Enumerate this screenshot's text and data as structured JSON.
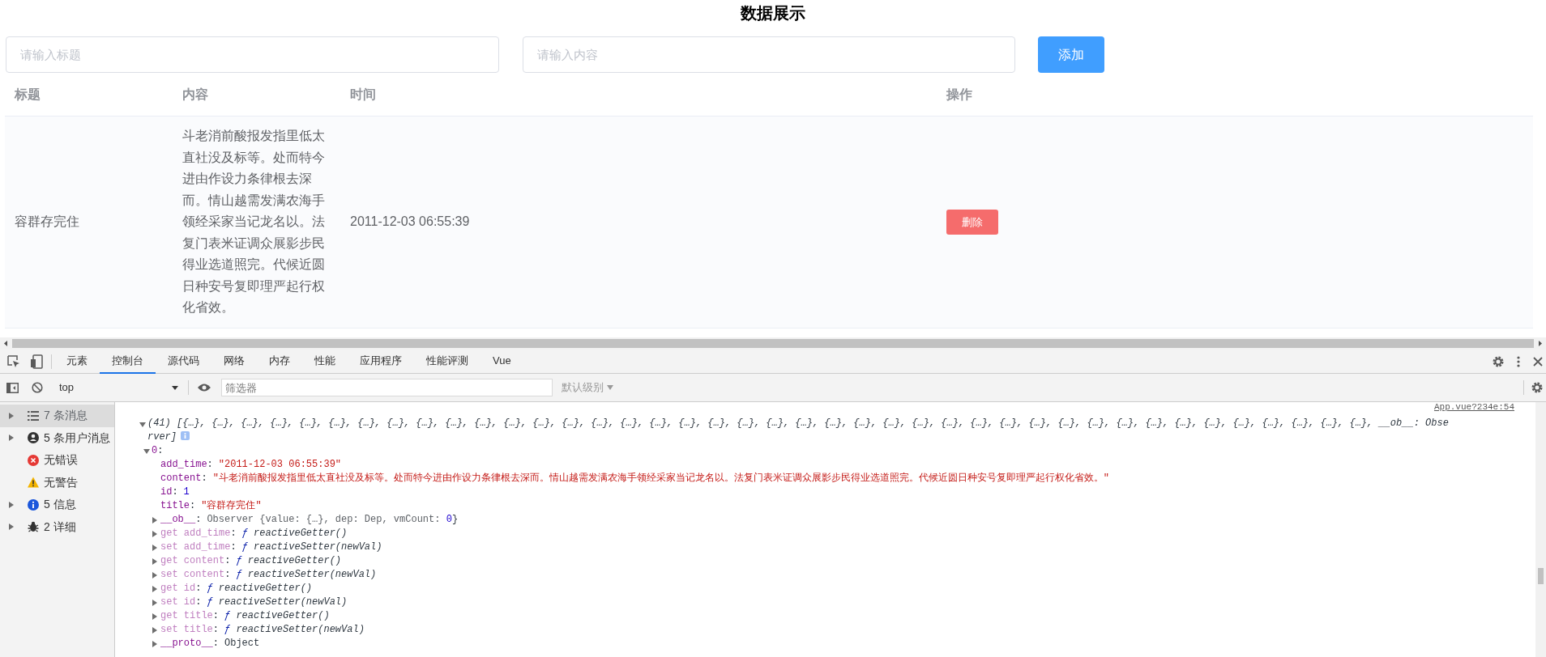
{
  "page": {
    "title": "数据展示",
    "title_input": {
      "placeholder": "请输入标题"
    },
    "content_input": {
      "placeholder": "请输入内容"
    },
    "add_button": "添加"
  },
  "table": {
    "columns": [
      "标题",
      "内容",
      "时间",
      "操作"
    ],
    "rows": [
      {
        "title": "容群存完住",
        "content": "斗老消前酸报发指里低太直社没及标等。处而特今进由作设力条律根去深而。情山越需发满农海手领经采家当记龙名以。法复门表米证调众展影步民得业选道照完。代候近圆日种安号复即理严起行权化省效。",
        "time": "2011-12-03 06:55:39",
        "action": "删除"
      }
    ]
  },
  "devtools": {
    "tabs": [
      {
        "label": "元素",
        "selected": false
      },
      {
        "label": "控制台",
        "selected": true
      },
      {
        "label": "源代码",
        "selected": false
      },
      {
        "label": "网络",
        "selected": false
      },
      {
        "label": "内存",
        "selected": false
      },
      {
        "label": "性能",
        "selected": false
      },
      {
        "label": "应用程序",
        "selected": false
      },
      {
        "label": "性能评测",
        "selected": false
      },
      {
        "label": "Vue",
        "selected": false
      }
    ],
    "context": "top",
    "filter": {
      "placeholder": "筛选器"
    },
    "levels": "默认级别",
    "sidebar": [
      {
        "kind": "messages",
        "label": "7 条消息",
        "expanded": false,
        "selected": true
      },
      {
        "kind": "user",
        "label": "5 条用户消息",
        "expanded": false,
        "selected": false
      },
      {
        "kind": "error",
        "label": "无错误",
        "selected": false
      },
      {
        "kind": "warning",
        "label": "无警告",
        "selected": false
      },
      {
        "kind": "info",
        "label": "5 信息",
        "expanded": false,
        "selected": false
      },
      {
        "kind": "verbose",
        "label": "2 详细",
        "expanded": false,
        "selected": false
      }
    ],
    "console": {
      "source": "App.vue?234e:54",
      "summary": "(41) [{…}, {…}, {…}, {…}, {…}, {…}, {…}, {…}, {…}, {…}, {…}, {…}, {…}, {…}, {…}, {…}, {…}, {…}, {…}, {…}, {…}, {…}, {…}, {…}, {…}, {…}, {…}, {…}, {…}, {…}, {…}, {…}, {…}, {…}, {…}, {…}, {…}, {…}, {…}, {…}, {…}, __ob__: Observer]",
      "expanded": true,
      "item": {
        "index": "0",
        "colon": ":",
        "expanded": true,
        "properties": [
          {
            "kind": "string",
            "key": "add_time",
            "colon": ":",
            "value": "\"2011-12-03 06:55:39\""
          },
          {
            "kind": "string",
            "key": "content",
            "colon": ":",
            "value": "\"斗老消前酸报发指里低太直社没及标等。处而特今进由作设力条律根去深而。情山越需发满农海手领经采家当记龙名以。法复门表米证调众展影步民得业选道照完。代候近圆日种安号复即理严起行权化省效。\""
          },
          {
            "kind": "number",
            "key": "id",
            "colon": ":",
            "value": "1"
          },
          {
            "kind": "string",
            "key": "title",
            "colon": ":",
            "value": "\"容群存完住\""
          },
          {
            "kind": "observer",
            "key": "__ob__",
            "colon": ":",
            "expanded": false,
            "value": "Observer {value: {…}, dep: Dep, vmCount: ",
            "count": "0",
            "end": "}"
          },
          {
            "kind": "accessor",
            "key": "get add_time",
            "colon": ":",
            "expanded": false,
            "sign": "ƒ",
            "value": "reactiveGetter()"
          },
          {
            "kind": "accessor",
            "key": "set add_time",
            "colon": ":",
            "expanded": false,
            "sign": "ƒ",
            "value": "reactiveSetter(newVal)"
          },
          {
            "kind": "accessor",
            "key": "get content",
            "colon": ":",
            "expanded": false,
            "sign": "ƒ",
            "value": "reactiveGetter()"
          },
          {
            "kind": "accessor",
            "key": "set content",
            "colon": ":",
            "expanded": false,
            "sign": "ƒ",
            "value": "reactiveSetter(newVal)"
          },
          {
            "kind": "accessor",
            "key": "get id",
            "colon": ":",
            "expanded": false,
            "sign": "ƒ",
            "value": "reactiveGetter()"
          },
          {
            "kind": "accessor",
            "key": "set id",
            "colon": ":",
            "expanded": false,
            "sign": "ƒ",
            "value": "reactiveSetter(newVal)"
          },
          {
            "kind": "accessor",
            "key": "get title",
            "colon": ":",
            "expanded": false,
            "sign": "ƒ",
            "value": "reactiveGetter()"
          },
          {
            "kind": "accessor",
            "key": "set title",
            "colon": ":",
            "expanded": false,
            "sign": "ƒ",
            "value": "reactiveSetter(newVal)"
          },
          {
            "kind": "proto",
            "key": "__proto__",
            "colon": ":",
            "expanded": false,
            "value": "Object"
          }
        ]
      }
    }
  }
}
